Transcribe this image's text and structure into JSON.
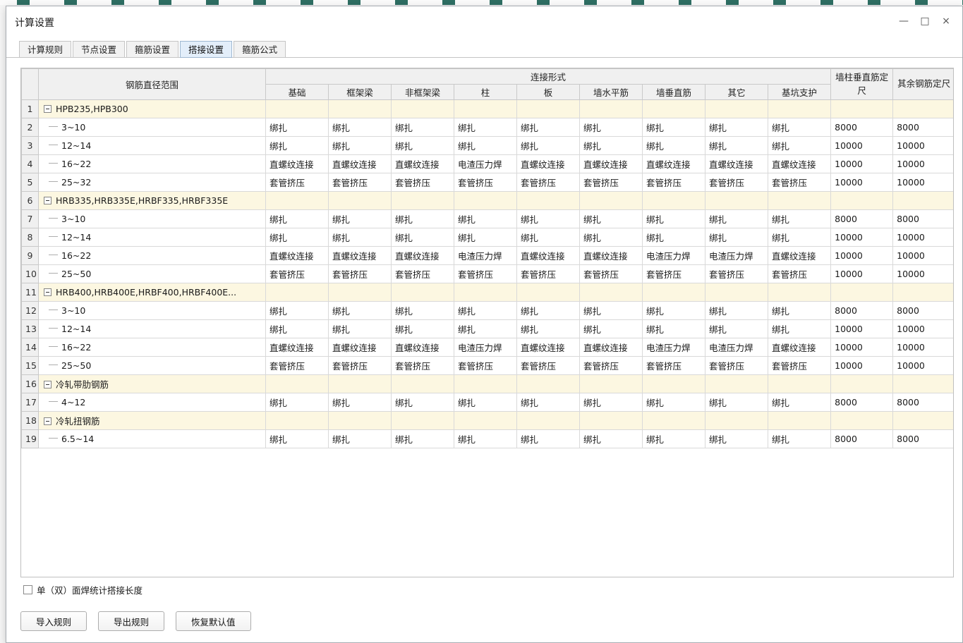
{
  "window": {
    "title": "计算设置"
  },
  "window_controls": [
    {
      "name": "minimize",
      "glyph": "—"
    },
    {
      "name": "maximize",
      "glyph": "□"
    },
    {
      "name": "close",
      "glyph": "×"
    }
  ],
  "tabs": [
    {
      "label": "计算规则",
      "active": false
    },
    {
      "label": "节点设置",
      "active": false
    },
    {
      "label": "箍筋设置",
      "active": false
    },
    {
      "label": "搭接设置",
      "active": true
    },
    {
      "label": "箍筋公式",
      "active": false
    }
  ],
  "table": {
    "headers": {
      "row_label": "钢筋直径范围",
      "connection_group": "连接形式",
      "connection_columns": [
        "基础",
        "框架梁",
        "非框架梁",
        "柱",
        "板",
        "墙水平筋",
        "墙垂直筋",
        "其它",
        "基坑支护"
      ],
      "fixed_length_columns": [
        "墙柱垂直筋定尺",
        "其余钢筋定尺"
      ]
    },
    "rows": [
      {
        "num": "1",
        "type": "group",
        "label": "HPB235,HPB300"
      },
      {
        "num": "2",
        "type": "data",
        "label": "3~10",
        "connections": [
          "绑扎",
          "绑扎",
          "绑扎",
          "绑扎",
          "绑扎",
          "绑扎",
          "绑扎",
          "绑扎",
          "绑扎"
        ],
        "wall_col_len": "8000",
        "other_len": "8000"
      },
      {
        "num": "3",
        "type": "data",
        "label": "12~14",
        "connections": [
          "绑扎",
          "绑扎",
          "绑扎",
          "绑扎",
          "绑扎",
          "绑扎",
          "绑扎",
          "绑扎",
          "绑扎"
        ],
        "wall_col_len": "10000",
        "other_len": "10000"
      },
      {
        "num": "4",
        "type": "data",
        "label": "16~22",
        "connections": [
          "直螺纹连接",
          "直螺纹连接",
          "直螺纹连接",
          "电渣压力焊",
          "直螺纹连接",
          "直螺纹连接",
          "直螺纹连接",
          "直螺纹连接",
          "直螺纹连接"
        ],
        "wall_col_len": "10000",
        "other_len": "10000"
      },
      {
        "num": "5",
        "type": "data",
        "label": "25~32",
        "connections": [
          "套管挤压",
          "套管挤压",
          "套管挤压",
          "套管挤压",
          "套管挤压",
          "套管挤压",
          "套管挤压",
          "套管挤压",
          "套管挤压"
        ],
        "wall_col_len": "10000",
        "other_len": "10000"
      },
      {
        "num": "6",
        "type": "group",
        "label": "HRB335,HRB335E,HRBF335,HRBF335E"
      },
      {
        "num": "7",
        "type": "data",
        "label": "3~10",
        "connections": [
          "绑扎",
          "绑扎",
          "绑扎",
          "绑扎",
          "绑扎",
          "绑扎",
          "绑扎",
          "绑扎",
          "绑扎"
        ],
        "wall_col_len": "8000",
        "other_len": "8000"
      },
      {
        "num": "8",
        "type": "data",
        "label": "12~14",
        "connections": [
          "绑扎",
          "绑扎",
          "绑扎",
          "绑扎",
          "绑扎",
          "绑扎",
          "绑扎",
          "绑扎",
          "绑扎"
        ],
        "wall_col_len": "10000",
        "other_len": "10000"
      },
      {
        "num": "9",
        "type": "data",
        "label": "16~22",
        "connections": [
          "直螺纹连接",
          "直螺纹连接",
          "直螺纹连接",
          "电渣压力焊",
          "直螺纹连接",
          "直螺纹连接",
          "电渣压力焊",
          "电渣压力焊",
          "直螺纹连接"
        ],
        "wall_col_len": "10000",
        "other_len": "10000"
      },
      {
        "num": "10",
        "type": "data",
        "label": "25~50",
        "connections": [
          "套管挤压",
          "套管挤压",
          "套管挤压",
          "套管挤压",
          "套管挤压",
          "套管挤压",
          "套管挤压",
          "套管挤压",
          "套管挤压"
        ],
        "wall_col_len": "10000",
        "other_len": "10000"
      },
      {
        "num": "11",
        "type": "group",
        "label": "HRB400,HRB400E,HRBF400,HRBF400E..."
      },
      {
        "num": "12",
        "type": "data",
        "label": "3~10",
        "connections": [
          "绑扎",
          "绑扎",
          "绑扎",
          "绑扎",
          "绑扎",
          "绑扎",
          "绑扎",
          "绑扎",
          "绑扎"
        ],
        "wall_col_len": "8000",
        "other_len": "8000"
      },
      {
        "num": "13",
        "type": "data",
        "label": "12~14",
        "connections": [
          "绑扎",
          "绑扎",
          "绑扎",
          "绑扎",
          "绑扎",
          "绑扎",
          "绑扎",
          "绑扎",
          "绑扎"
        ],
        "wall_col_len": "10000",
        "other_len": "10000"
      },
      {
        "num": "14",
        "type": "data",
        "label": "16~22",
        "connections": [
          "直螺纹连接",
          "直螺纹连接",
          "直螺纹连接",
          "电渣压力焊",
          "直螺纹连接",
          "直螺纹连接",
          "电渣压力焊",
          "电渣压力焊",
          "直螺纹连接"
        ],
        "wall_col_len": "10000",
        "other_len": "10000"
      },
      {
        "num": "15",
        "type": "data",
        "label": "25~50",
        "connections": [
          "套管挤压",
          "套管挤压",
          "套管挤压",
          "套管挤压",
          "套管挤压",
          "套管挤压",
          "套管挤压",
          "套管挤压",
          "套管挤压"
        ],
        "wall_col_len": "10000",
        "other_len": "10000"
      },
      {
        "num": "16",
        "type": "group",
        "label": "冷轧带肋钢筋"
      },
      {
        "num": "17",
        "type": "data",
        "label": "4~12",
        "connections": [
          "绑扎",
          "绑扎",
          "绑扎",
          "绑扎",
          "绑扎",
          "绑扎",
          "绑扎",
          "绑扎",
          "绑扎"
        ],
        "wall_col_len": "8000",
        "other_len": "8000"
      },
      {
        "num": "18",
        "type": "group",
        "label": "冷轧扭钢筋"
      },
      {
        "num": "19",
        "type": "data",
        "label": "6.5~14",
        "connections": [
          "绑扎",
          "绑扎",
          "绑扎",
          "绑扎",
          "绑扎",
          "绑扎",
          "绑扎",
          "绑扎",
          "绑扎"
        ],
        "wall_col_len": "8000",
        "other_len": "8000"
      }
    ]
  },
  "footer": {
    "checkbox": {
      "label": "单（双）面焊统计搭接长度",
      "checked": false
    },
    "buttons": [
      {
        "label": "导入规则"
      },
      {
        "label": "导出规则"
      },
      {
        "label": "恢复默认值"
      }
    ]
  }
}
